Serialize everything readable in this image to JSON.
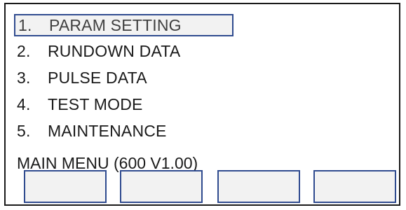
{
  "menu": {
    "items": [
      {
        "number": "1.",
        "label": "PARAM SETTING",
        "selected": true
      },
      {
        "number": "2.",
        "label": "RUNDOWN DATA",
        "selected": false
      },
      {
        "number": "3.",
        "label": "PULSE DATA",
        "selected": false
      },
      {
        "number": "4.",
        "label": "TEST MODE",
        "selected": false
      },
      {
        "number": "5.",
        "label": "MAINTENANCE",
        "selected": false
      }
    ]
  },
  "status": {
    "title": "MAIN MENU  (600  V1.00)"
  },
  "softkeys": [
    {
      "label": ""
    },
    {
      "label": ""
    },
    {
      "label": ""
    },
    {
      "label": ""
    }
  ],
  "colors": {
    "selection_border": "#2f4b8f",
    "selection_fill": "#f2f2f2",
    "text": "#1a1a1a"
  }
}
